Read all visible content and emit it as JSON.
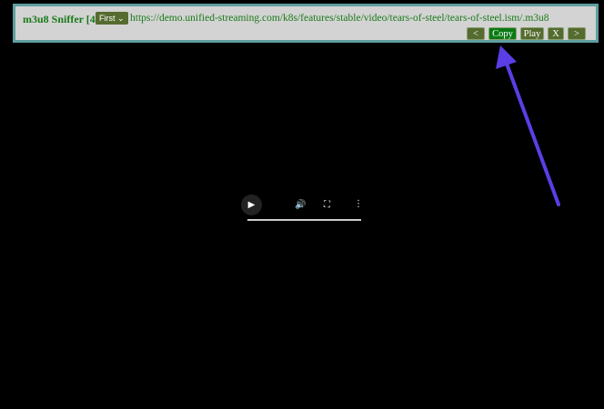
{
  "sniffer": {
    "title": "m3u8 Sniffer [4]",
    "select_value": "First",
    "url": "https://demo.unified-streaming.com/k8s/features/stable/video/tears-of-steel/tears-of-steel.ism/.m3u8",
    "buttons": {
      "prev": "<",
      "copy": "Copy",
      "play": "Play",
      "close": "X",
      "next": ">"
    }
  },
  "player": {
    "play_icon": "▶",
    "volume_icon": "🔊",
    "fullscreen_icon": "⛶",
    "more_icon": "⋮"
  },
  "colors": {
    "accent": "#1a7a1a",
    "button": "#556b2f",
    "copy": "#0a7a14",
    "arrow": "#5b3ee6"
  }
}
